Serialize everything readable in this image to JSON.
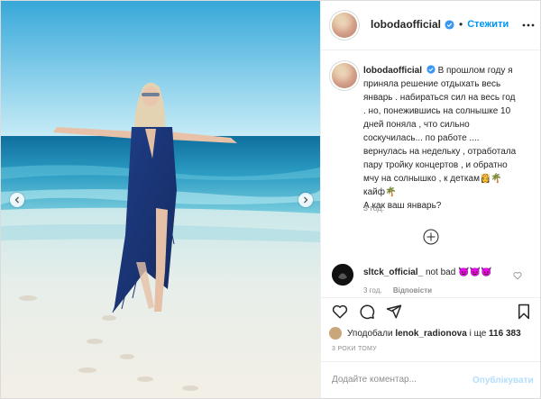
{
  "post": {
    "username": "lobodaofficial",
    "follow_label": "Стежити",
    "dot": "•",
    "caption_lines": [
      "В прошлом году я",
      "приняла решение отдыхать весь",
      "январь . набираться сил на весь год",
      ". но, понежившись на солнышке 10",
      "дней поняла , что сильно",
      "соскучилась... по работе ....",
      "вернулась на недельку , отработала",
      "пару тройку концертов , и обратно",
      "мчу на солнышко , к деткам👸🌴",
      "кайф🌴",
      "А как ваш январь?"
    ],
    "caption_time": "3 год."
  },
  "comment": {
    "username": "sltck_official_",
    "text": "not bad 😈😈😈",
    "time": "3 год.",
    "reply_label": "Відповісти"
  },
  "likes": {
    "prefix": "Уподобали",
    "user": "lenok_radionova",
    "suffix": "і ще",
    "count": "116 383"
  },
  "time_ago": "3 РОКИ ТОМУ",
  "add_comment": {
    "placeholder": "Додайте коментар...",
    "publish_label": "Опублікувати"
  },
  "icons": {
    "verified": "verified-badge-icon",
    "more": "more-options-icon",
    "load_more": "plus-circle-icon",
    "like": "heart-icon",
    "comment": "comment-icon",
    "share": "share-icon",
    "save": "bookmark-icon",
    "prev": "chevron-left-icon",
    "next": "chevron-right-icon"
  },
  "colors": {
    "link_blue": "#0095f6",
    "verified_blue": "#3897f0",
    "publish_disabled": "#b2dffc",
    "muted_text": "#8e8e8e"
  }
}
